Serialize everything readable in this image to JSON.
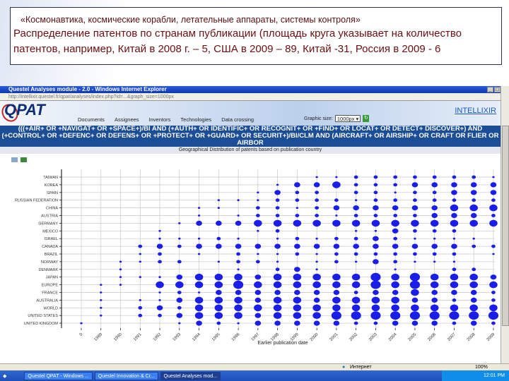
{
  "slide": {
    "subtitle": "«Космонавтика, космические корабли, летательные аппараты, системы контроля»",
    "description_line1": "Распределение патентов по странам публикации (площадь  круга указывает на  количество",
    "description_line2": "патентов, например,  Китай в 2008 г. – 5, США  в 2009 – 89, Китай -31, Россия в 2009 - 6"
  },
  "browser": {
    "title": "Questel Analyses module - 2.0 - Windows Internet Explorer",
    "window_buttons": [
      "_",
      "□",
      "×"
    ],
    "address": "http://intellixir.questel.fr/qpat/analyses/index.php?id=...&graph_size=1000px",
    "logo": "QPAT",
    "brand": "INTELLIXIR",
    "nav": [
      "Documents",
      "Assignees",
      "Inventors",
      "Technologies",
      "Data crossing"
    ],
    "graphic_size_label": "Graphic size:",
    "graphic_size_value": "1000px ▾",
    "query": "(((+AIR+ OR +NAVIGAT+ OR +SPACE+)/BI AND (+AUTH+ OR IDENTIFIC+ OR RECOGNIT+ OR +FIND+ OR LOCAT+ OR DETECT+ DISCOVER+) AND (+CONTROL+ OR +DEFENC+ OR DEFENS+ OR +PROTECT+ OR +GUARD+ OR SECURIT+)/BI/CLM AND (AIRCRAFT+ OR AIRSHIP+ OR CRAFT OR FLIER OR AIRBOR",
    "graph_title": "Geographical Distribution of patents based on publication country",
    "status_zone": "Интернет",
    "zoom": "100%",
    "taskbar": [
      "Questel QPAT - Windows ...",
      "Questel Innovation & Cr...",
      "Questel Analyses mod..."
    ],
    "clock": "12:01 PM"
  },
  "chart_data": {
    "type": "scatter",
    "title": "Geographical Distribution of patents based on publication country",
    "xlabel": "Earlier publication date",
    "ylabel": "",
    "x_categories": [
      "0",
      "1989",
      "1990",
      "1991",
      "1992",
      "1993",
      "1994",
      "1995",
      "1996",
      "1997",
      "1998",
      "1999",
      "2000",
      "2001",
      "2002",
      "2003",
      "2004",
      "2005",
      "2006",
      "2007",
      "2008",
      "2009"
    ],
    "y_categories": [
      "TAIWAN",
      "KOREA",
      "SPAIN",
      "RUSSIAN FEDERATION",
      "CHINA",
      "AUSTRIA",
      "GERMANY",
      "MEXICO",
      "ISRAEL",
      "CANADA",
      "BRAZIL",
      "NORWAY",
      "DENMARK",
      "JAPAN",
      "EUROPE",
      "FRANCE",
      "AUSTRALIA",
      "WORLD",
      "UNITED STATES",
      "UNITED KINGDOM"
    ],
    "size_scale": "relative bubble size level 0-5 (0 = none)",
    "values": [
      [
        0,
        0,
        0,
        0,
        0,
        0,
        0,
        0,
        0,
        0,
        0,
        0,
        1,
        1,
        2,
        2,
        2,
        2,
        2,
        2,
        2,
        1
      ],
      [
        0,
        0,
        0,
        0,
        0,
        0,
        0,
        0,
        0,
        0,
        1,
        3,
        3,
        4,
        2,
        2,
        2,
        3,
        3,
        3,
        3,
        3
      ],
      [
        0,
        0,
        0,
        0,
        0,
        0,
        0,
        0,
        0,
        1,
        3,
        2,
        2,
        0,
        2,
        2,
        1,
        2,
        2,
        3,
        3,
        3
      ],
      [
        0,
        0,
        0,
        0,
        0,
        0,
        0,
        1,
        1,
        1,
        2,
        2,
        2,
        2,
        1,
        2,
        2,
        2,
        2,
        2,
        2,
        2
      ],
      [
        0,
        0,
        0,
        0,
        0,
        0,
        1,
        1,
        0,
        2,
        2,
        1,
        2,
        3,
        3,
        3,
        3,
        3,
        3,
        4,
        4,
        4
      ],
      [
        0,
        0,
        0,
        0,
        0,
        0,
        1,
        0,
        1,
        2,
        2,
        2,
        2,
        1,
        2,
        2,
        2,
        2,
        3,
        3,
        3,
        2
      ],
      [
        0,
        0,
        0,
        0,
        0,
        1,
        3,
        3,
        3,
        4,
        4,
        4,
        4,
        4,
        4,
        4,
        4,
        4,
        4,
        4,
        4,
        4
      ],
      [
        0,
        0,
        0,
        0,
        1,
        0,
        0,
        0,
        0,
        1,
        2,
        0,
        0,
        0,
        1,
        1,
        3,
        2,
        2,
        2,
        0,
        0
      ],
      [
        0,
        0,
        0,
        0,
        1,
        1,
        1,
        2,
        1,
        0,
        1,
        2,
        1,
        2,
        2,
        3,
        2,
        1,
        1,
        1,
        1,
        0
      ],
      [
        0,
        0,
        0,
        2,
        3,
        2,
        3,
        3,
        3,
        3,
        3,
        3,
        3,
        3,
        3,
        3,
        3,
        3,
        3,
        3,
        2,
        2
      ],
      [
        0,
        0,
        0,
        1,
        2,
        0,
        1,
        0,
        2,
        1,
        1,
        2,
        1,
        2,
        2,
        2,
        2,
        2,
        2,
        2,
        0,
        1
      ],
      [
        0,
        0,
        1,
        1,
        2,
        2,
        0,
        1,
        2,
        2,
        1,
        0,
        1,
        2,
        1,
        3,
        2,
        1,
        1,
        1,
        0,
        0
      ],
      [
        0,
        0,
        1,
        0,
        0,
        0,
        0,
        0,
        1,
        0,
        2,
        3,
        1,
        0,
        0,
        0,
        1,
        0,
        0,
        2,
        2,
        0
      ],
      [
        0,
        0,
        1,
        1,
        1,
        3,
        4,
        4,
        4,
        3,
        4,
        4,
        4,
        4,
        4,
        5,
        4,
        5,
        4,
        4,
        4,
        3
      ],
      [
        0,
        1,
        1,
        0,
        4,
        4,
        4,
        4,
        5,
        4,
        4,
        4,
        4,
        4,
        4,
        5,
        4,
        5,
        4,
        4,
        4,
        4
      ],
      [
        0,
        1,
        0,
        0,
        1,
        2,
        1,
        3,
        3,
        3,
        3,
        3,
        3,
        3,
        2,
        3,
        3,
        4,
        3,
        3,
        3,
        2
      ],
      [
        0,
        1,
        0,
        1,
        1,
        3,
        4,
        4,
        4,
        3,
        4,
        4,
        3,
        4,
        4,
        4,
        4,
        3,
        3,
        2,
        3,
        2
      ],
      [
        0,
        1,
        0,
        2,
        3,
        2,
        4,
        4,
        4,
        4,
        4,
        4,
        4,
        4,
        4,
        4,
        4,
        4,
        4,
        4,
        4,
        4
      ],
      [
        0,
        1,
        0,
        2,
        2,
        3,
        4,
        4,
        4,
        3,
        4,
        4,
        4,
        5,
        5,
        5,
        5,
        5,
        5,
        5,
        5,
        5
      ],
      [
        1,
        0,
        0,
        0,
        0,
        1,
        3,
        2,
        1,
        3,
        3,
        3,
        3,
        3,
        2,
        2,
        3,
        3,
        3,
        2,
        3,
        2
      ]
    ],
    "marker_color": "#1a1ee8",
    "grid": true
  }
}
